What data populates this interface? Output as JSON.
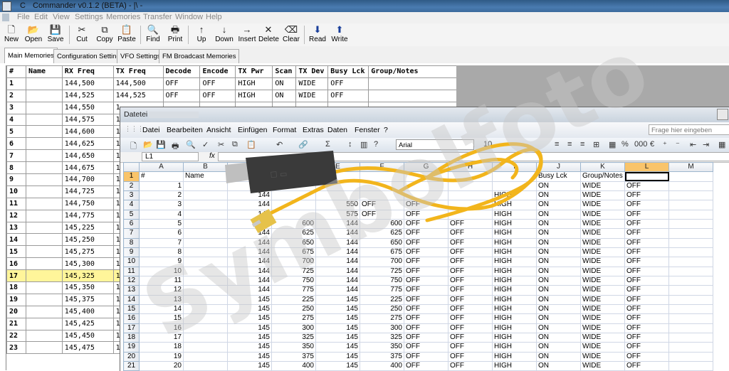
{
  "window": {
    "app_letter": "C",
    "title": "Commander v0.1.2 (BETA) - |\\ -"
  },
  "menu": [
    "File",
    "Edit",
    "View",
    "Settings",
    "Memories",
    "Transfer",
    "Window",
    "Help"
  ],
  "toolbar": [
    {
      "label": "New",
      "icon": "new-file-icon",
      "glyph": "🗋"
    },
    {
      "label": "Open",
      "icon": "open-folder-icon",
      "glyph": "📂"
    },
    {
      "label": "Save",
      "icon": "save-icon",
      "glyph": "💾"
    },
    {
      "label": "Cut",
      "icon": "cut-icon",
      "glyph": "✂"
    },
    {
      "label": "Copy",
      "icon": "copy-icon",
      "glyph": "⧉"
    },
    {
      "label": "Paste",
      "icon": "paste-icon",
      "glyph": "📋"
    },
    {
      "label": "Find",
      "icon": "find-icon",
      "glyph": "🔍"
    },
    {
      "label": "Print",
      "icon": "print-icon",
      "glyph": "🖶"
    },
    {
      "label": "Up",
      "icon": "arrow-up-icon",
      "glyph": "↑"
    },
    {
      "label": "Down",
      "icon": "arrow-down-icon",
      "glyph": "↓"
    },
    {
      "label": "Insert",
      "icon": "insert-icon",
      "glyph": "→"
    },
    {
      "label": "Delete",
      "icon": "delete-icon",
      "glyph": "✕"
    },
    {
      "label": "Clear",
      "icon": "eraser-icon",
      "glyph": "⌫"
    },
    {
      "label": "Read",
      "icon": "read-arrow-down-icon",
      "glyph": "⬇"
    },
    {
      "label": "Write",
      "icon": "write-arrow-up-icon",
      "glyph": "⬆"
    }
  ],
  "tabs": [
    "Main Memories",
    "Configuration Settings",
    "VFO Settings",
    "FM Broadcast Memories"
  ],
  "grid": {
    "headers": [
      "#",
      "Name",
      "RX Freq",
      "TX Freq",
      "Decode",
      "Encode",
      "TX Pwr",
      "Scan",
      "TX Dev",
      "Busy Lck",
      "Group/Notes"
    ],
    "rows": [
      [
        "1",
        "",
        "144,500",
        "144,500",
        "OFF",
        "OFF",
        "HIGH",
        "ON",
        "WIDE",
        "OFF",
        ""
      ],
      [
        "2",
        "",
        "144,525",
        "144,525",
        "OFF",
        "OFF",
        "HIGH",
        "ON",
        "WIDE",
        "OFF",
        ""
      ],
      [
        "3",
        "",
        "144,550",
        "1",
        "",
        "",
        "",
        "",
        "",
        "",
        ""
      ],
      [
        "4",
        "",
        "144,575",
        "1",
        "",
        "",
        "",
        "",
        "",
        "",
        ""
      ],
      [
        "5",
        "",
        "144,600",
        "1",
        "",
        "",
        "",
        "",
        "",
        "",
        ""
      ],
      [
        "6",
        "",
        "144,625",
        "1",
        "",
        "",
        "",
        "",
        "",
        "",
        ""
      ],
      [
        "7",
        "",
        "144,650",
        "1",
        "",
        "",
        "",
        "",
        "",
        "",
        ""
      ],
      [
        "8",
        "",
        "144,675",
        "1",
        "",
        "",
        "",
        "",
        "",
        "",
        ""
      ],
      [
        "9",
        "",
        "144,700",
        "1",
        "",
        "",
        "",
        "",
        "",
        "",
        ""
      ],
      [
        "10",
        "",
        "144,725",
        "1",
        "",
        "",
        "",
        "",
        "",
        "",
        ""
      ],
      [
        "11",
        "",
        "144,750",
        "1",
        "",
        "",
        "",
        "",
        "",
        "",
        ""
      ],
      [
        "12",
        "",
        "144,775",
        "1",
        "",
        "",
        "",
        "",
        "",
        "",
        ""
      ],
      [
        "13",
        "",
        "145,225",
        "1",
        "",
        "",
        "",
        "",
        "",
        "",
        ""
      ],
      [
        "14",
        "",
        "145,250",
        "1",
        "",
        "",
        "",
        "",
        "",
        "",
        ""
      ],
      [
        "15",
        "",
        "145,275",
        "1",
        "",
        "",
        "",
        "",
        "",
        "",
        ""
      ],
      [
        "16",
        "",
        "145,300",
        "1",
        "",
        "",
        "",
        "",
        "",
        "",
        ""
      ],
      [
        "17",
        "",
        "145,325",
        "1",
        "",
        "",
        "",
        "",
        "",
        "",
        ""
      ],
      [
        "18",
        "",
        "145,350",
        "1",
        "",
        "",
        "",
        "",
        "",
        "",
        ""
      ],
      [
        "19",
        "",
        "145,375",
        "1",
        "",
        "",
        "",
        "",
        "",
        "",
        ""
      ],
      [
        "20",
        "",
        "145,400",
        "1",
        "",
        "",
        "",
        "",
        "",
        "",
        ""
      ],
      [
        "21",
        "",
        "145,425",
        "1",
        "",
        "",
        "",
        "",
        "",
        "",
        ""
      ],
      [
        "22",
        "",
        "145,450",
        "1",
        "",
        "",
        "",
        "",
        "",
        "",
        ""
      ],
      [
        "23",
        "",
        "145,475",
        "1",
        "",
        "",
        "",
        "",
        "",
        "",
        ""
      ]
    ],
    "selected_row": "17",
    "selected_color": "#fff59a"
  },
  "excel": {
    "title": "Datetei",
    "menu": [
      "Datei",
      "Bearbeiten",
      "Ansicht",
      "Einfügen",
      "Format",
      "Extras",
      "Daten",
      "Fenster",
      "?"
    ],
    "search_placeholder": "Frage hier eingeben",
    "font": "Arial",
    "font_size": "10",
    "name_box": "L1",
    "fx": "fx",
    "col_headers": [
      "A",
      "B",
      "C",
      "D",
      "E",
      "F",
      "G",
      "H",
      "I",
      "J",
      "K",
      "L",
      "M"
    ],
    "active_col": "L",
    "rows": [
      {
        "r": "1",
        "c": [
          "#",
          "Name",
          "",
          "",
          "",
          "",
          "",
          "",
          "",
          "Busy Lck",
          "Group/Notes",
          "",
          ""
        ]
      },
      {
        "r": "2",
        "c": [
          "1",
          "",
          "",
          "",
          "",
          "",
          "",
          "",
          "",
          "ON",
          "WIDE",
          "OFF",
          ""
        ]
      },
      {
        "r": "3",
        "c": [
          "2",
          "",
          "144",
          "",
          "",
          "",
          "",
          "",
          "HIGH",
          "ON",
          "WIDE",
          "OFF",
          ""
        ]
      },
      {
        "r": "4",
        "c": [
          "3",
          "",
          "144",
          "",
          "550",
          "OFF",
          "OFF",
          "",
          "HIGH",
          "ON",
          "WIDE",
          "OFF",
          ""
        ]
      },
      {
        "r": "5",
        "c": [
          "4",
          "",
          "144",
          "",
          "575",
          "OFF",
          "OFF",
          "",
          "HIGH",
          "ON",
          "WIDE",
          "OFF",
          ""
        ]
      },
      {
        "r": "6",
        "c": [
          "5",
          "",
          "144",
          "600",
          "144",
          "600",
          "OFF",
          "OFF",
          "HIGH",
          "ON",
          "WIDE",
          "OFF",
          ""
        ]
      },
      {
        "r": "7",
        "c": [
          "6",
          "",
          "144",
          "625",
          "144",
          "625",
          "OFF",
          "OFF",
          "HIGH",
          "ON",
          "WIDE",
          "OFF",
          ""
        ]
      },
      {
        "r": "8",
        "c": [
          "7",
          "",
          "144",
          "650",
          "144",
          "650",
          "OFF",
          "OFF",
          "HIGH",
          "ON",
          "WIDE",
          "OFF",
          ""
        ]
      },
      {
        "r": "9",
        "c": [
          "8",
          "",
          "144",
          "675",
          "144",
          "675",
          "OFF",
          "OFF",
          "HIGH",
          "ON",
          "WIDE",
          "OFF",
          ""
        ]
      },
      {
        "r": "10",
        "c": [
          "9",
          "",
          "144",
          "700",
          "144",
          "700",
          "OFF",
          "OFF",
          "HIGH",
          "ON",
          "WIDE",
          "OFF",
          ""
        ]
      },
      {
        "r": "11",
        "c": [
          "10",
          "",
          "144",
          "725",
          "144",
          "725",
          "OFF",
          "OFF",
          "HIGH",
          "ON",
          "WIDE",
          "OFF",
          ""
        ]
      },
      {
        "r": "12",
        "c": [
          "11",
          "",
          "144",
          "750",
          "144",
          "750",
          "OFF",
          "OFF",
          "HIGH",
          "ON",
          "WIDE",
          "OFF",
          ""
        ]
      },
      {
        "r": "13",
        "c": [
          "12",
          "",
          "144",
          "775",
          "144",
          "775",
          "OFF",
          "OFF",
          "HIGH",
          "ON",
          "WIDE",
          "OFF",
          ""
        ]
      },
      {
        "r": "14",
        "c": [
          "13",
          "",
          "145",
          "225",
          "145",
          "225",
          "OFF",
          "OFF",
          "HIGH",
          "ON",
          "WIDE",
          "OFF",
          ""
        ]
      },
      {
        "r": "15",
        "c": [
          "14",
          "",
          "145",
          "250",
          "145",
          "250",
          "OFF",
          "OFF",
          "HIGH",
          "ON",
          "WIDE",
          "OFF",
          ""
        ]
      },
      {
        "r": "16",
        "c": [
          "15",
          "",
          "145",
          "275",
          "145",
          "275",
          "OFF",
          "OFF",
          "HIGH",
          "ON",
          "WIDE",
          "OFF",
          ""
        ]
      },
      {
        "r": "17",
        "c": [
          "16",
          "",
          "145",
          "300",
          "145",
          "300",
          "OFF",
          "OFF",
          "HIGH",
          "ON",
          "WIDE",
          "OFF",
          ""
        ]
      },
      {
        "r": "18",
        "c": [
          "17",
          "",
          "145",
          "325",
          "145",
          "325",
          "OFF",
          "OFF",
          "HIGH",
          "ON",
          "WIDE",
          "OFF",
          ""
        ]
      },
      {
        "r": "19",
        "c": [
          "18",
          "",
          "145",
          "350",
          "145",
          "350",
          "OFF",
          "OFF",
          "HIGH",
          "ON",
          "WIDE",
          "OFF",
          ""
        ]
      },
      {
        "r": "20",
        "c": [
          "19",
          "",
          "145",
          "375",
          "145",
          "375",
          "OFF",
          "OFF",
          "HIGH",
          "ON",
          "WIDE",
          "OFF",
          ""
        ]
      },
      {
        "r": "21",
        "c": [
          "20",
          "",
          "145",
          "400",
          "145",
          "400",
          "OFF",
          "OFF",
          "HIGH",
          "ON",
          "WIDE",
          "OFF",
          ""
        ]
      }
    ]
  },
  "watermark": "Symbolfoto",
  "colors": {
    "cable": "#f2b51c",
    "plug": "#3a3a3a",
    "selection": "#fff59a",
    "active_header": "#f9c46a"
  }
}
